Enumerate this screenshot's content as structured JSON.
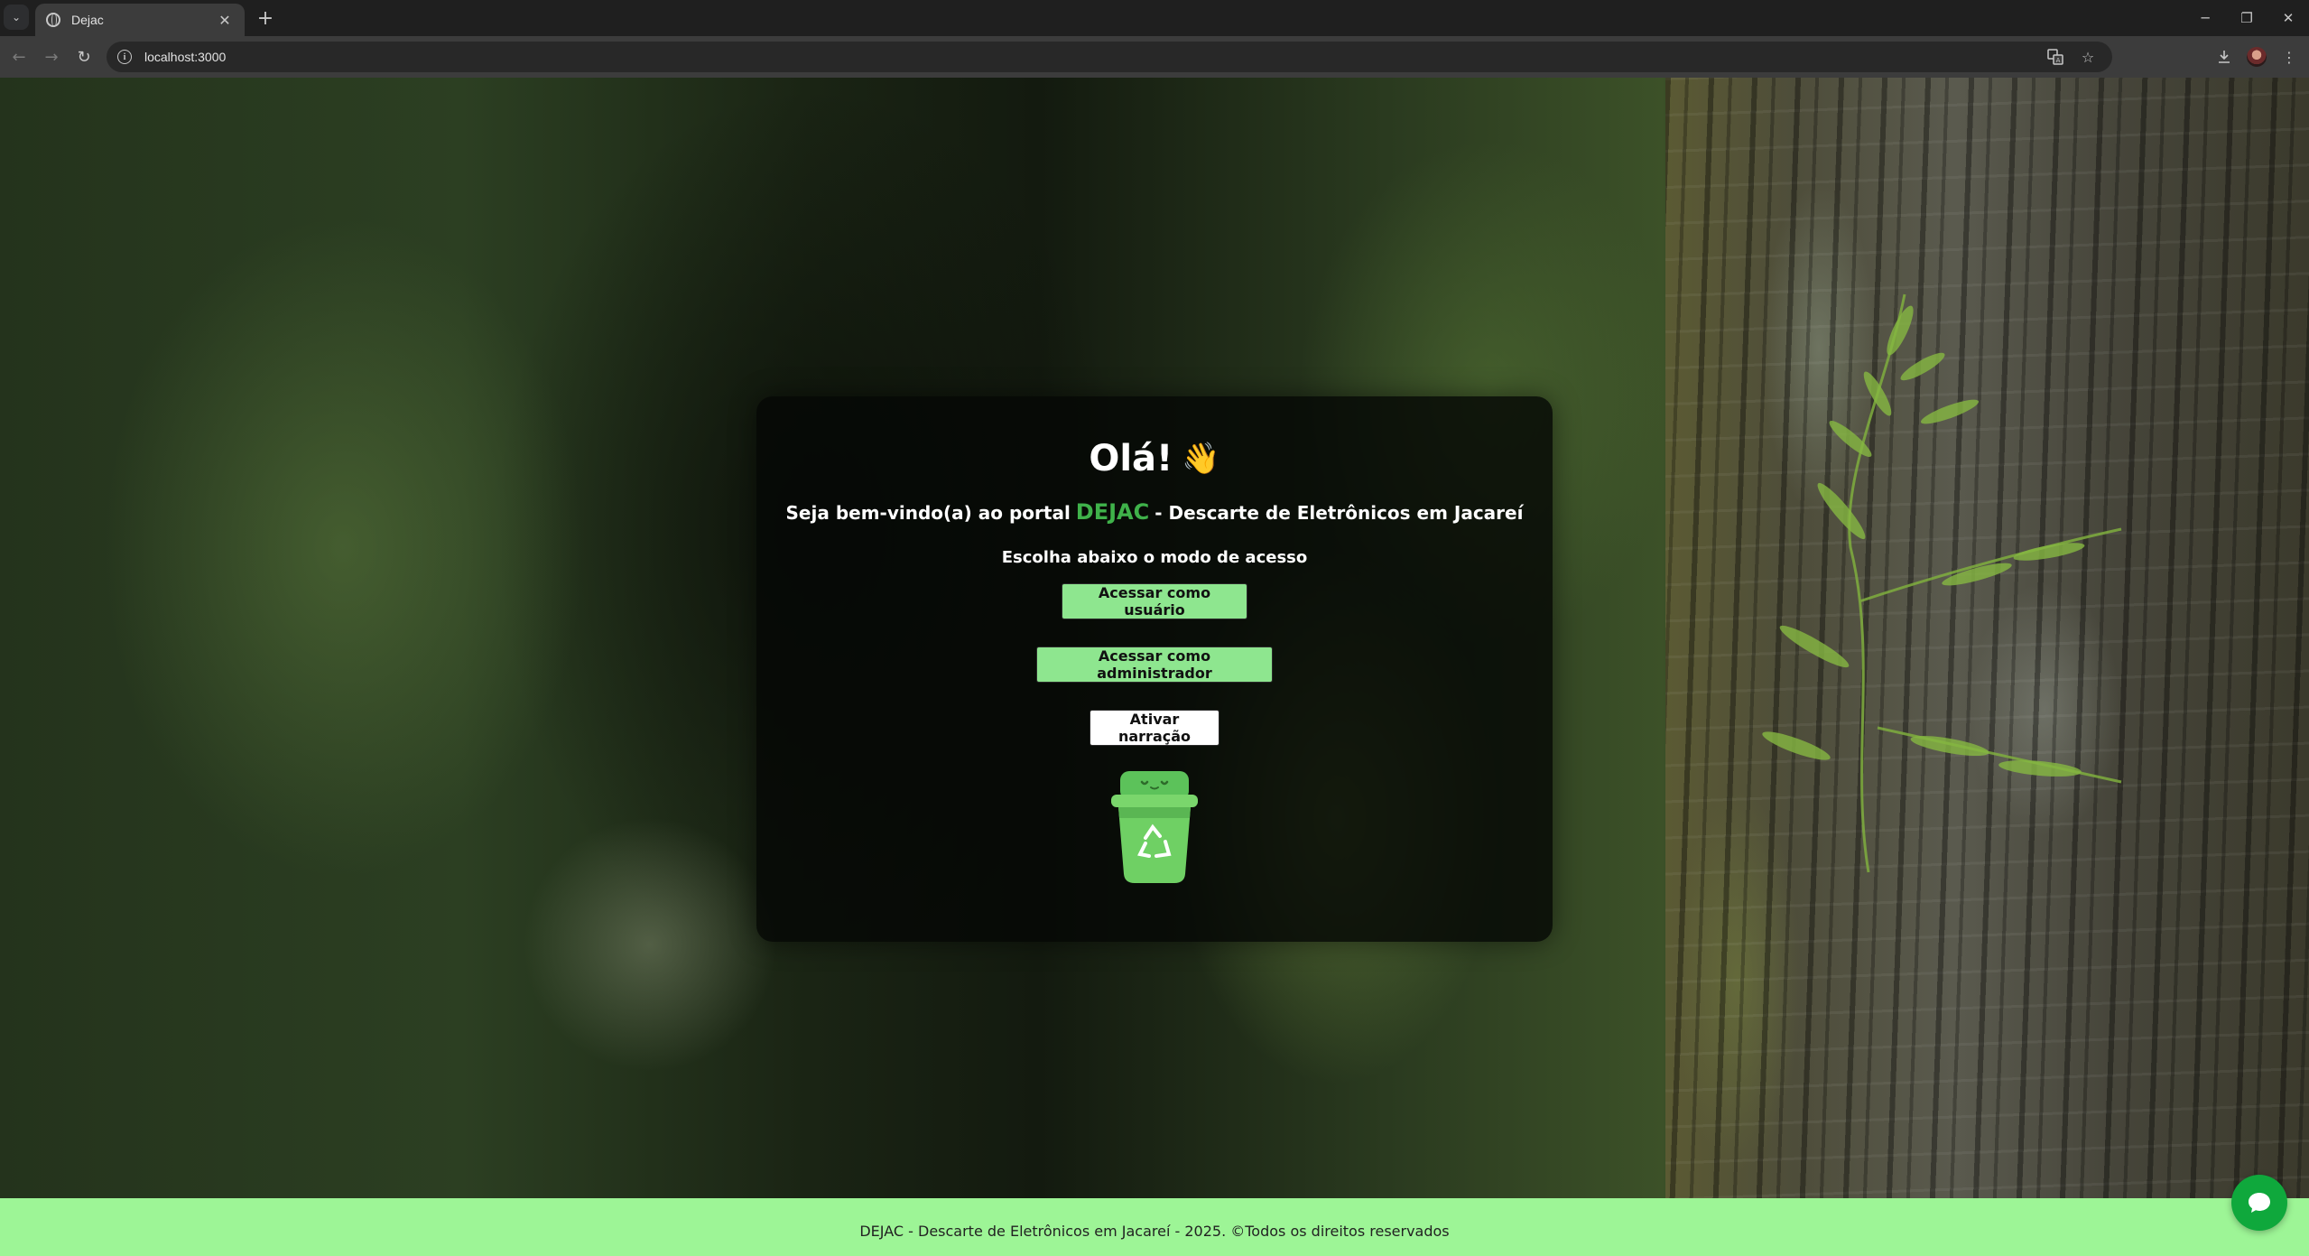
{
  "browser": {
    "tab": {
      "title": "Dejac",
      "favicon": "globe-icon"
    },
    "address_bar": {
      "url": "localhost:3000"
    },
    "window_controls": [
      "minimize",
      "restore",
      "close"
    ]
  },
  "page": {
    "greeting": "Olá!",
    "greeting_emoji": "👋",
    "welcome_prefix": "Seja bem-vindo(a) ao portal",
    "brand": "DEJAC",
    "welcome_suffix": "- Descarte de Eletrônicos em Jacareí",
    "choose_text": "Escolha abaixo o modo de acesso",
    "buttons": {
      "user": "Acessar como usuário",
      "admin": "Acessar como administrador",
      "narration": "Ativar narração"
    },
    "mascot": "recycle-bin-mascot-icon"
  },
  "footer": {
    "text": "DEJAC - Descarte de Eletrônicos em Jacareí - 2025. ©Todos os direitos reservados"
  },
  "colors": {
    "brand_green": "#3fb24a",
    "button_green": "#8ee68f",
    "footer_green": "#9df596",
    "chat_green": "#0fa83c"
  }
}
